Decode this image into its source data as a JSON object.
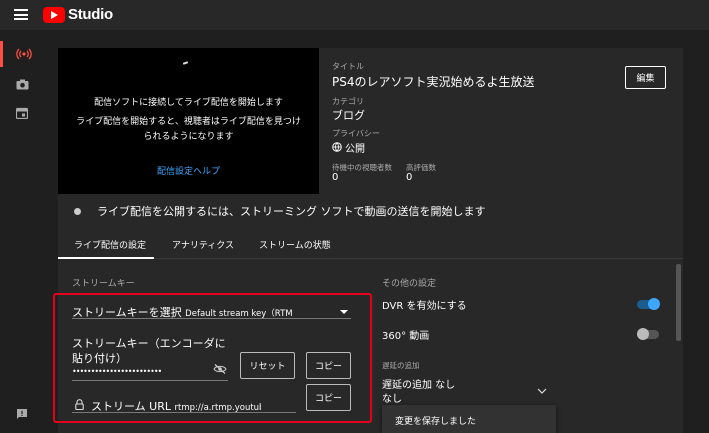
{
  "header": {
    "logo_text": "Studio"
  },
  "nav": {
    "items": [
      "live-icon",
      "camera-icon",
      "calendar-icon",
      "feedback-icon"
    ],
    "active": "live-icon",
    "accent": "#ff4e45"
  },
  "preview": {
    "message1": "配信ソフトに接続してライブ配信を開始します",
    "message2": "ライブ配信を開始すると、視聴者はライブ配信を見つけられるようになります",
    "help_link": "配信設定ヘルプ"
  },
  "details": {
    "title_label": "タイトル",
    "title": "PS4のレアソフト実況始めるよ生放送",
    "category_label": "カテゴリ",
    "category": "ブログ",
    "privacy_label": "プライバシー",
    "privacy": "公開",
    "waiting_label": "待機中の視聴者数",
    "waiting_value": "0",
    "likes_label": "高評価数",
    "likes_value": "0",
    "edit_button": "編集"
  },
  "status": {
    "text": "ライブ配信を公開するには、ストリーミング ソフトで動画の送信を開始します"
  },
  "tabs": [
    {
      "label": "ライブ配信の設定",
      "active": true
    },
    {
      "label": "アナリティクス",
      "active": false
    },
    {
      "label": "ストリームの状態",
      "active": false
    }
  ],
  "stream_key": {
    "section_title": "ストリームキー",
    "select_label": "ストリームキーを選択",
    "select_value": "Default stream key（RTM",
    "key_label": "ストリームキー（エンコーダに貼り付け）",
    "key_masked": "••••••••••••••••••••••••",
    "reset_button": "リセット",
    "copy_button": "コピー",
    "url_label": "ストリーム URL",
    "url_value": "rtmp://a.rtmp.youtube.c",
    "url_copy_button": "コピー"
  },
  "other_settings": {
    "section_title": "その他の設定",
    "dvr_label": "DVR を有効にする",
    "dvr_enabled": true,
    "vr360_label": "360° 動画",
    "vr360_enabled": false,
    "latency_title": "遅延の追加",
    "latency_label": "遅延の追加 なし",
    "latency_value": "なし"
  },
  "snackbar": {
    "text": "変更を保存しました"
  },
  "colors": {
    "accent_blue": "#3ea6ff",
    "highlight_red": "#e3001b",
    "brand_red": "#ff0000"
  }
}
